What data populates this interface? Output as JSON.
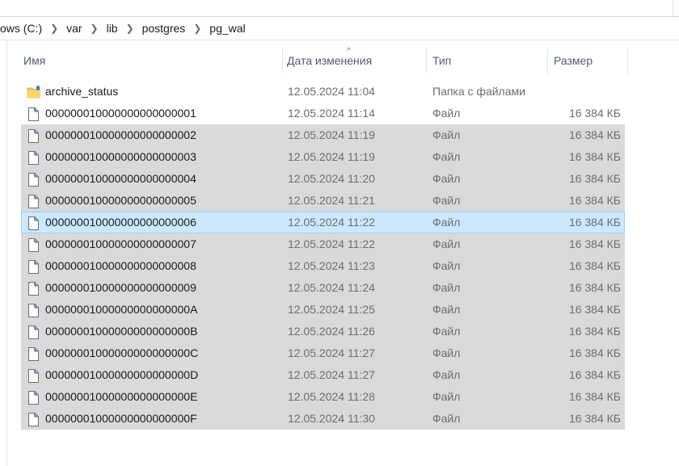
{
  "breadcrumb": [
    "ows (C:)",
    "var",
    "lib",
    "postgres",
    "pg_wal"
  ],
  "columns": {
    "name": "Имя",
    "date": "Дата изменения",
    "type": "Тип",
    "size": "Размер"
  },
  "sort_indicator": "^",
  "colors": {
    "selection": "#d9d9d9",
    "focus": "#cce8ff",
    "focus_border": "#99d1ff",
    "folder": "#f5c84c",
    "header_text": "#4d5b70"
  },
  "rows": [
    {
      "name": "archive_status",
      "date": "12.05.2024 11:04",
      "type": "Папка с файлами",
      "size": "",
      "icon": "folder-icon",
      "state": "none"
    },
    {
      "name": "000000010000000000000001",
      "date": "12.05.2024 11:14",
      "type": "Файл",
      "size": "16 384 КБ",
      "icon": "file-icon",
      "state": "none"
    },
    {
      "name": "000000010000000000000002",
      "date": "12.05.2024 11:19",
      "type": "Файл",
      "size": "16 384 КБ",
      "icon": "file-icon",
      "state": "selected"
    },
    {
      "name": "000000010000000000000003",
      "date": "12.05.2024 11:19",
      "type": "Файл",
      "size": "16 384 КБ",
      "icon": "file-icon",
      "state": "selected"
    },
    {
      "name": "000000010000000000000004",
      "date": "12.05.2024 11:20",
      "type": "Файл",
      "size": "16 384 КБ",
      "icon": "file-icon",
      "state": "selected"
    },
    {
      "name": "000000010000000000000005",
      "date": "12.05.2024 11:21",
      "type": "Файл",
      "size": "16 384 КБ",
      "icon": "file-icon",
      "state": "selected"
    },
    {
      "name": "000000010000000000000006",
      "date": "12.05.2024 11:22",
      "type": "Файл",
      "size": "16 384 КБ",
      "icon": "file-icon",
      "state": "focused"
    },
    {
      "name": "000000010000000000000007",
      "date": "12.05.2024 11:22",
      "type": "Файл",
      "size": "16 384 КБ",
      "icon": "file-icon",
      "state": "selected"
    },
    {
      "name": "000000010000000000000008",
      "date": "12.05.2024 11:23",
      "type": "Файл",
      "size": "16 384 КБ",
      "icon": "file-icon",
      "state": "selected"
    },
    {
      "name": "000000010000000000000009",
      "date": "12.05.2024 11:24",
      "type": "Файл",
      "size": "16 384 КБ",
      "icon": "file-icon",
      "state": "selected"
    },
    {
      "name": "00000001000000000000000A",
      "date": "12.05.2024 11:25",
      "type": "Файл",
      "size": "16 384 КБ",
      "icon": "file-icon",
      "state": "selected"
    },
    {
      "name": "00000001000000000000000B",
      "date": "12.05.2024 11:26",
      "type": "Файл",
      "size": "16 384 КБ",
      "icon": "file-icon",
      "state": "selected"
    },
    {
      "name": "00000001000000000000000C",
      "date": "12.05.2024 11:27",
      "type": "Файл",
      "size": "16 384 КБ",
      "icon": "file-icon",
      "state": "selected"
    },
    {
      "name": "00000001000000000000000D",
      "date": "12.05.2024 11:27",
      "type": "Файл",
      "size": "16 384 КБ",
      "icon": "file-icon",
      "state": "selected"
    },
    {
      "name": "00000001000000000000000E",
      "date": "12.05.2024 11:28",
      "type": "Файл",
      "size": "16 384 КБ",
      "icon": "file-icon",
      "state": "selected"
    },
    {
      "name": "00000001000000000000000F",
      "date": "12.05.2024 11:30",
      "type": "Файл",
      "size": "16 384 КБ",
      "icon": "file-icon",
      "state": "selected"
    }
  ]
}
